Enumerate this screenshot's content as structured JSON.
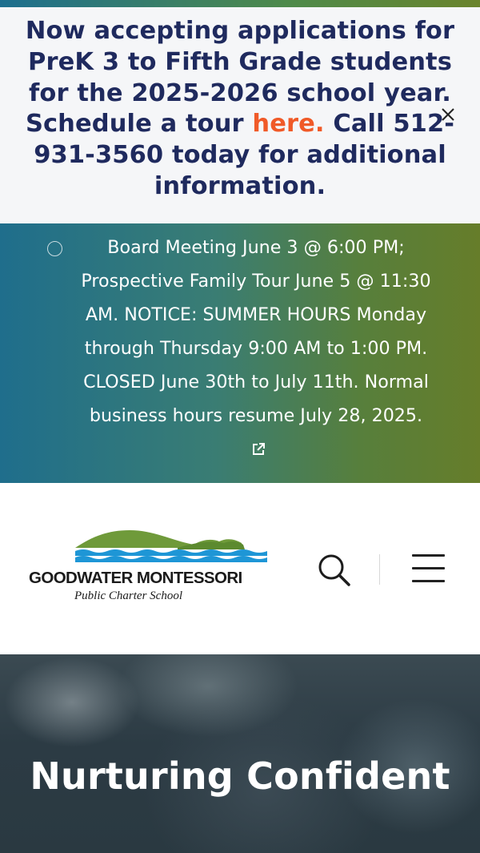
{
  "announcement": {
    "text_before": "Now accepting applications for PreK 3 to Fifth Grade students for the 2025-2026 school year. Schedule a tour ",
    "link_text": "here.",
    "text_after": " Call 512-931-3560 today for additional information.",
    "close_icon": "close-icon",
    "colors": {
      "text": "#1f2a5e",
      "link": "#f05a28",
      "background": "#f5f6f8"
    }
  },
  "notice": {
    "text": "Board Meeting June 3 @ 6:00 PM; Prospective Family Tour June 5 @ 11:30 AM. NOTICE: SUMMER HOURS Monday through Thursday 9:00 AM to 1:00 PM. CLOSED June 30th to July 11th. Normal business hours resume July 28, 2025.",
    "bullet_icon": "circle-bullet-icon",
    "link_icon": "external-link-icon"
  },
  "header": {
    "logo_name": "GOODWATER MONTESSORI",
    "logo_tagline": "Public Charter School",
    "search_icon": "search-icon",
    "menu_icon": "hamburger-menu-icon"
  },
  "hero": {
    "title": "Nurturing Confident"
  }
}
